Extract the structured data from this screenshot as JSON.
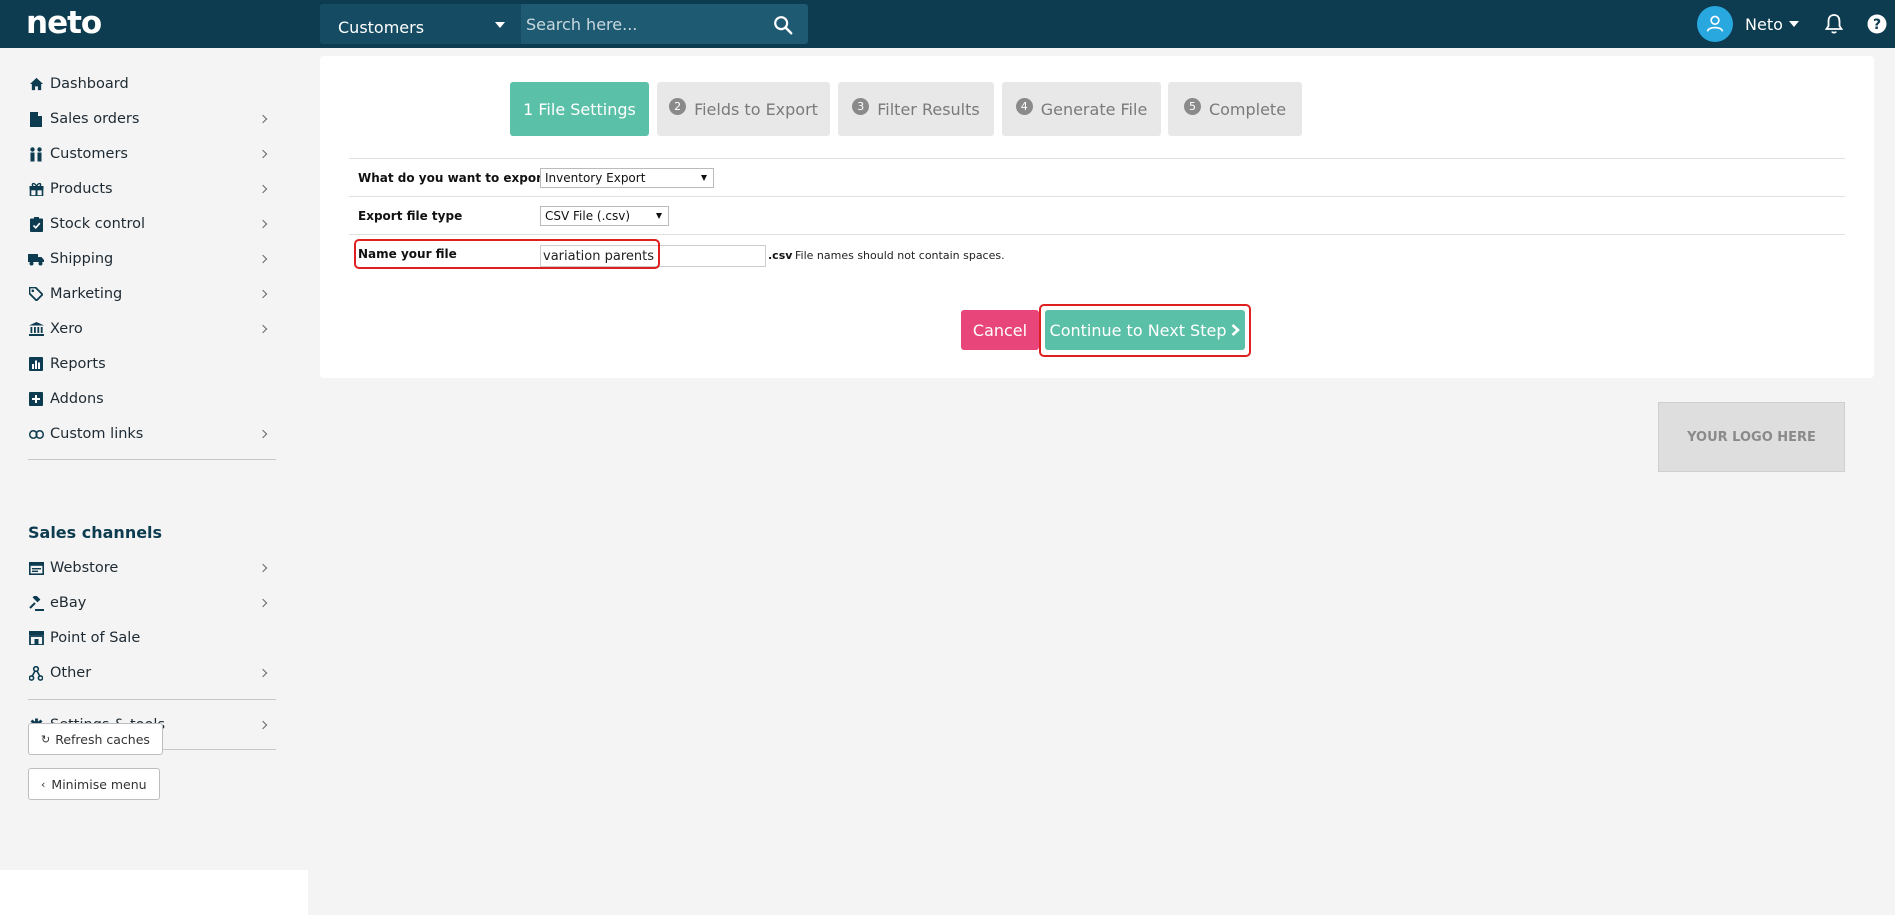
{
  "topbar": {
    "logo": "neto",
    "search_scope": "Customers",
    "search_placeholder": "Search here...",
    "user_name": "Neto"
  },
  "sidebar": {
    "items": [
      {
        "label": "Dashboard",
        "icon": "home-icon",
        "chevron": false
      },
      {
        "label": "Sales orders",
        "icon": "file-icon",
        "chevron": true
      },
      {
        "label": "Customers",
        "icon": "users-icon",
        "chevron": true
      },
      {
        "label": "Products",
        "icon": "gift-icon",
        "chevron": true
      },
      {
        "label": "Stock control",
        "icon": "clipboard-check-icon",
        "chevron": true
      },
      {
        "label": "Shipping",
        "icon": "truck-icon",
        "chevron": true
      },
      {
        "label": "Marketing",
        "icon": "tag-icon",
        "chevron": true
      },
      {
        "label": "Xero",
        "icon": "bank-icon",
        "chevron": true
      },
      {
        "label": "Reports",
        "icon": "bar-chart-icon",
        "chevron": false
      },
      {
        "label": "Addons",
        "icon": "plus-square-icon",
        "chevron": false
      },
      {
        "label": "Custom links",
        "icon": "link-icon",
        "chevron": true
      }
    ],
    "channels_heading": "Sales channels",
    "channels": [
      {
        "label": "Webstore",
        "icon": "browser-icon",
        "chevron": true
      },
      {
        "label": "eBay",
        "icon": "gavel-icon",
        "chevron": true
      },
      {
        "label": "Point of Sale",
        "icon": "store-icon",
        "chevron": false
      },
      {
        "label": "Other",
        "icon": "sitemap-icon",
        "chevron": true
      }
    ],
    "settings": {
      "label": "Settings & tools",
      "icon": "gear-icon",
      "chevron": true
    },
    "refresh_label": "Refresh caches",
    "minimise_label": "Minimise menu"
  },
  "wizard": {
    "steps": [
      {
        "num": "1",
        "label": "1 File Settings",
        "active": true
      },
      {
        "num": "2",
        "label": "Fields to Export",
        "active": false
      },
      {
        "num": "3",
        "label": "Filter Results",
        "active": false
      },
      {
        "num": "4",
        "label": "Generate File",
        "active": false
      },
      {
        "num": "5",
        "label": "Complete",
        "active": false
      }
    ]
  },
  "form": {
    "export_label": "What do you want to export?",
    "export_value": "Inventory Export",
    "filetype_label": "Export file type",
    "filetype_value": "CSV File (.csv)",
    "filename_label": "Name your file",
    "filename_value": "variation parents",
    "extension": ".csv",
    "hint": "File names should not contain spaces."
  },
  "actions": {
    "cancel_label": "Cancel",
    "next_label": "Continue to Next Step"
  },
  "logo_placeholder": "YOUR LOGO HERE",
  "colors": {
    "topbar": "#0d3b4f",
    "accent": "#5bc0a8",
    "cancel": "#e8467a",
    "highlight": "#e02020"
  }
}
